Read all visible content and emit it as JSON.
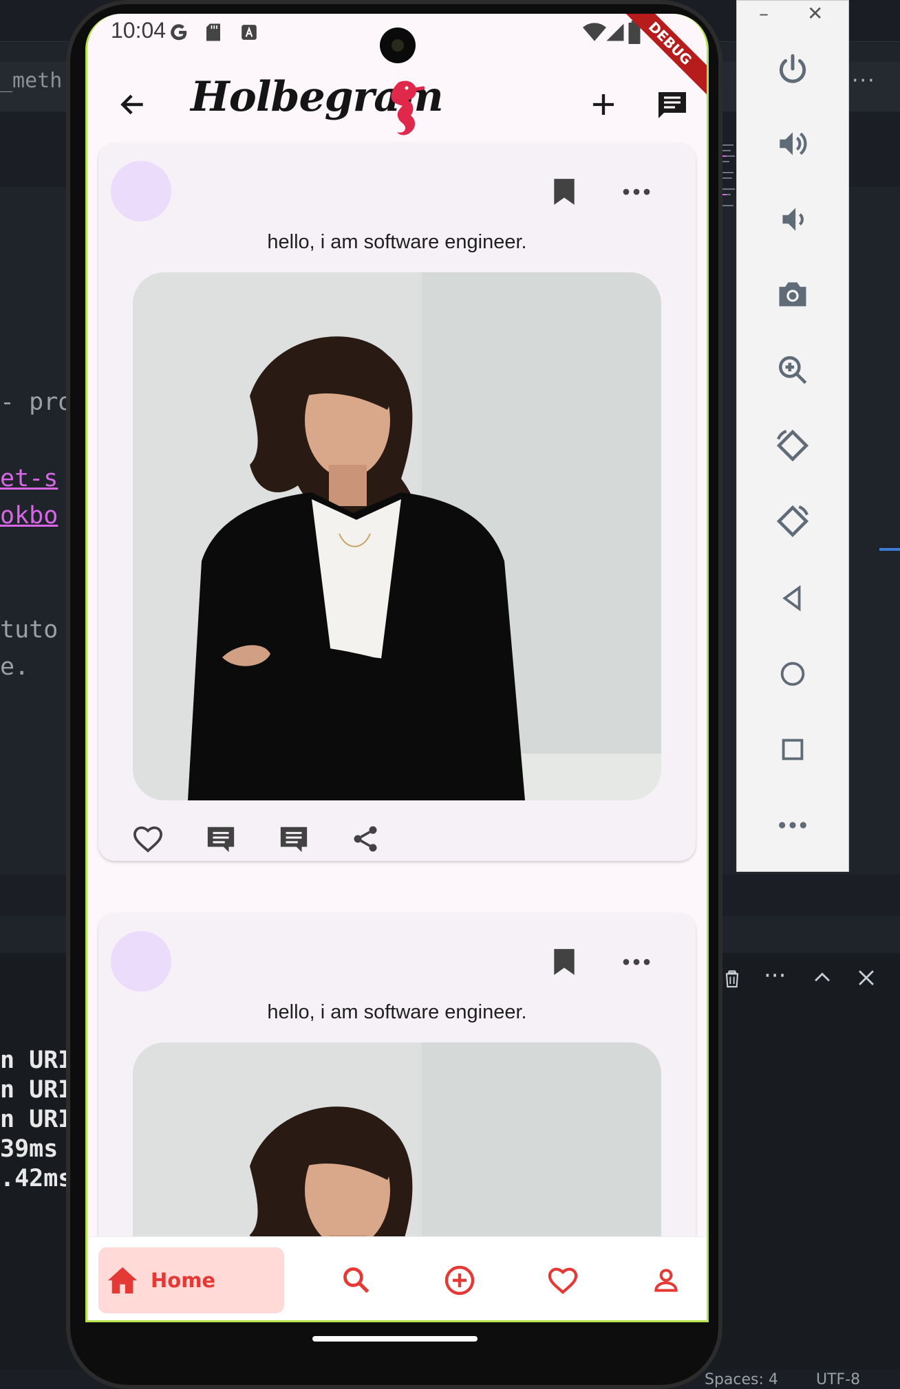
{
  "ide": {
    "tab_text": "_meth",
    "more_label": "···",
    "code_lines": [
      {
        "text": "- pro",
        "style": "gray"
      },
      {
        "text": "et-s",
        "style": "pink"
      },
      {
        "text": "okbo",
        "style": "pink"
      },
      {
        "text": "tuto",
        "style": "gray"
      },
      {
        "text": "e.",
        "style": "gray"
      },
      {
        "text": "n URI",
        "style": "white"
      },
      {
        "text": "n URI",
        "style": "white"
      },
      {
        "text": "n URI",
        "style": "white"
      },
      {
        "text": "39ms",
        "style": "white"
      },
      {
        "text": ".42ms",
        "style": "white"
      }
    ],
    "status_spaces": "Spaces: 4",
    "status_encoding": "UTF-8"
  },
  "emulator": {
    "minimize_label": "–",
    "close_label": "✕",
    "buttons": [
      "power-icon",
      "volume-up-icon",
      "volume-down-icon",
      "camera-icon",
      "zoom-in-icon",
      "rotate-left-icon",
      "rotate-right-icon",
      "back-triangle-icon",
      "home-circle-icon",
      "overview-square-icon",
      "more-dots-icon"
    ]
  },
  "status_bar": {
    "time": "10:04",
    "debug_label": "DEBUG"
  },
  "app_bar": {
    "title": "Holbegram"
  },
  "posts": [
    {
      "caption": "hello, i am software engineer."
    },
    {
      "caption": "hello, i am software engineer."
    }
  ],
  "bottom_nav": {
    "home_label": "Home",
    "accent": "#e53935"
  },
  "colors": {
    "accent": "#e53935",
    "avatar": "#ebdcfc",
    "card": "#f6f1f7"
  }
}
